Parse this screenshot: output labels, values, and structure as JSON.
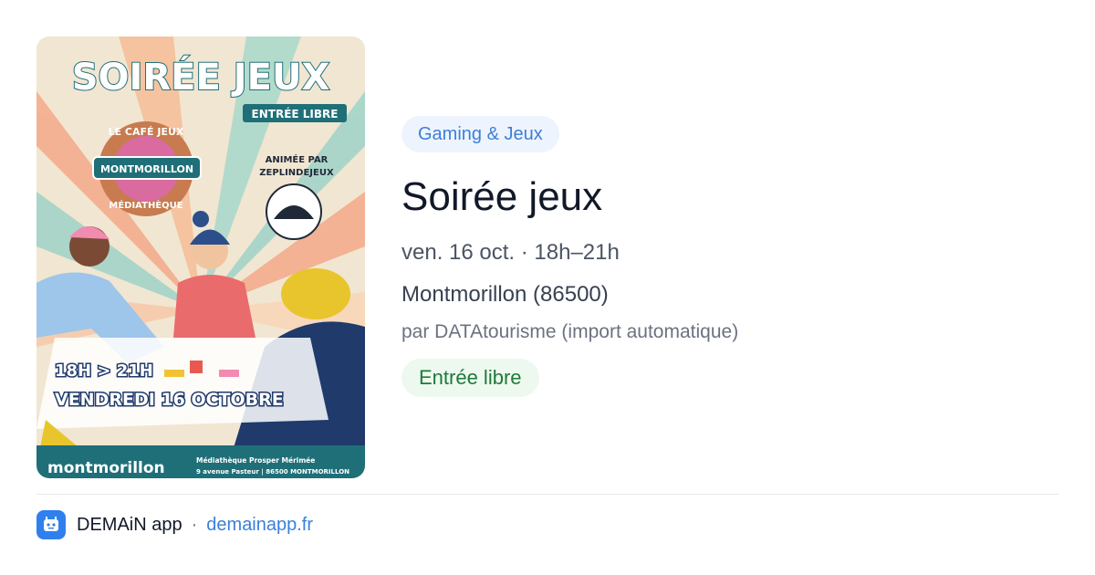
{
  "poster": {
    "heading": "SOIRÉE JEUX",
    "free_entry": "ENTRÉE LIBRE",
    "badge_top": "LE CAFÉ JEUX",
    "badge_middle": "MONTMORILLON",
    "badge_bottom": "MÉDIATHÈQUE",
    "animated_by": "ANIMÉE PAR",
    "animator": "ZEPLINDEJEUX",
    "hours": "18H > 21H",
    "day": "VENDREDI 16 OCTOBRE",
    "town_logo": "montmorillon",
    "venue_name": "Médiathèque Prosper Mérimée",
    "venue_address": "9 avenue Pasteur | 86500 MONTMORILLON"
  },
  "event": {
    "category": "Gaming & Jeux",
    "title": "Soirée jeux",
    "datetime": "ven. 16 oct. · 18h–21h",
    "location": "Montmorillon (86500)",
    "organizer": "par DATAtourisme (import automatique)",
    "price_badge": "Entrée libre"
  },
  "footer": {
    "app_name": "DEMAiN app",
    "separator": "·",
    "domain": "demainapp.fr"
  },
  "colors": {
    "accent_blue": "#3b7fd9",
    "category_bg": "#eef4fd",
    "badge_green": "#1f7a3a",
    "badge_green_bg": "#edf8ef",
    "poster_teal": "#1f6f78",
    "poster_navy": "#1f3a6b"
  }
}
